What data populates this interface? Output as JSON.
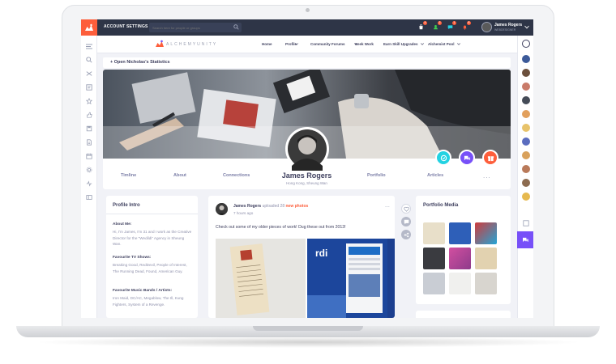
{
  "topbar": {
    "account_settings": "ACCOUNT SETTINGS",
    "search_placeholder": "Search here for people or groups",
    "notifications": [
      {
        "icon": "shopping-bag-icon",
        "color": "#ffffff",
        "badge": "4"
      },
      {
        "icon": "friends-icon",
        "color": "#40d04f",
        "badge": "2"
      },
      {
        "icon": "messages-icon",
        "color": "#23d2e2",
        "badge": "1"
      },
      {
        "icon": "notification-bell-icon",
        "color": "#fd5e3b",
        "badge": "8"
      }
    ],
    "user_name": "James Rogers",
    "user_subtitle": "WEBDESIGNER"
  },
  "header_nav": {
    "logo_text": "ALCHEMYUNITY",
    "items": [
      "Home",
      "Profile",
      "Community Forums",
      "Seek Work",
      "Earn Skill Upgrades",
      "Alchemist Pool"
    ],
    "has_dropdown": [
      false,
      true,
      true,
      false,
      true,
      true
    ]
  },
  "stats": {
    "label": "+ Open Nicholas's Statistics"
  },
  "profile": {
    "name": "James Rogers",
    "location": "Hong Kong, Sheung Wan",
    "tabs": [
      "Timline",
      "About",
      "Connections",
      "Portfolio",
      "Articles"
    ],
    "more": "..."
  },
  "intro": {
    "title": "Profile Intro",
    "about_head": "About Me:",
    "about_text": "Hi, I'm James, I'm 31 and I work as the Creative Director for the \"Wedildi\" Agency in Sheung Wan.",
    "tv_head": "Favourite TV Shows:",
    "tv_text": "Breaking Good, RedDevil, People of Interest, The Running Dead, Found, American Guy.",
    "music_head": "Favourite Music Bands / Artists:",
    "music_text": "Iron Maid, DC/AC, Megablow, The Ill, Kung Fighters, System of a Revenge."
  },
  "post": {
    "author": "James Rogers",
    "action": " uploaded 28 ",
    "highlight": "new photos",
    "time": "7 hours ago",
    "text": "Check out some of my older pieces of work! Dug these out from 2013!",
    "dots": "..."
  },
  "portfolio": {
    "title": "Portfolio Media"
  },
  "colors": {
    "topbar": "#2e3547",
    "brand": "#fd5e3b",
    "accent_purple": "#7750f8",
    "accent_cyan": "#23d2e2"
  }
}
